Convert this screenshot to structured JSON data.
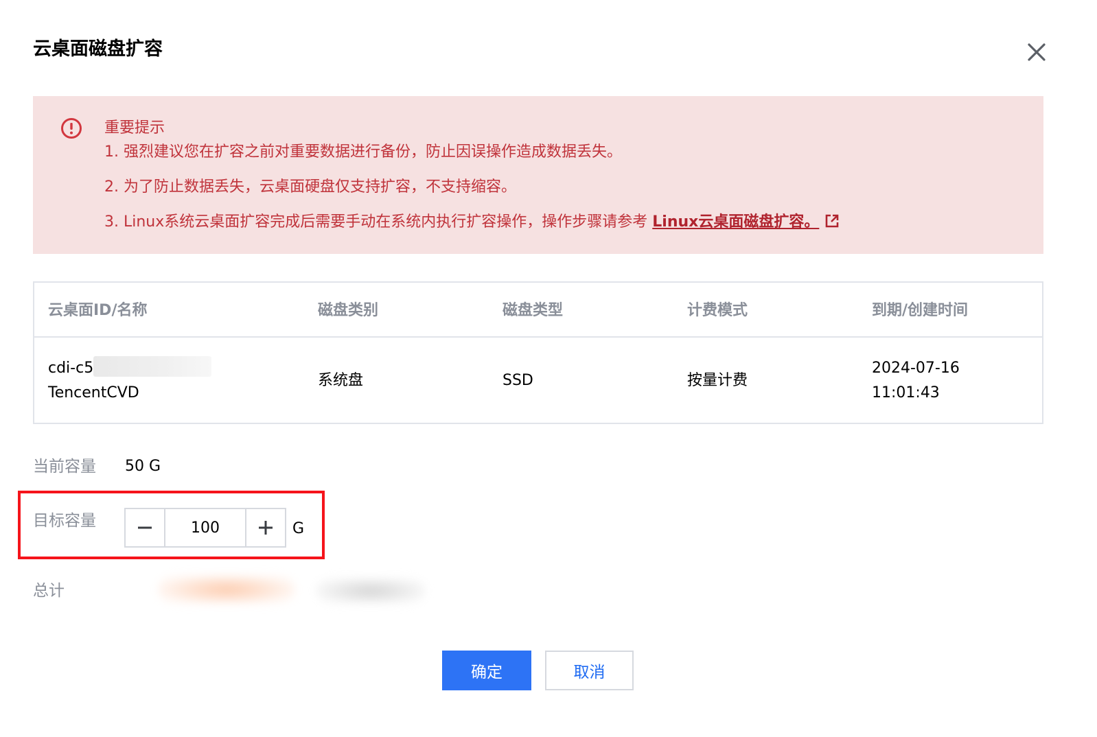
{
  "dialog": {
    "title": "云桌面磁盘扩容",
    "close_icon": "close-icon"
  },
  "alert": {
    "icon": "alert-circle-icon",
    "title": "重要提示",
    "line1": "1. 强烈建议您在扩容之前对重要数据进行备份，防止因误操作造成数据丢失。",
    "line2": "2. 为了防止数据丢失，云桌面硬盘仅支持扩容，不支持缩容。",
    "line3_prefix": "3. Linux系统云桌面扩容完成后需要手动在系统内执行扩容操作，操作步骤请参考 ",
    "line3_link": "Linux云桌面磁盘扩容。",
    "link_icon": "external-link-icon",
    "color": "#c0333b"
  },
  "table": {
    "headers": [
      "云桌面ID/名称",
      "磁盘类别",
      "磁盘类型",
      "计费模式",
      "到期/创建时间"
    ],
    "row": {
      "id": "cdi-c5",
      "name": "TencentCVD",
      "disk_category": "系统盘",
      "disk_type": "SSD",
      "billing": "按量计费",
      "date": "2024-07-16",
      "time": "11:01:43"
    }
  },
  "capacity": {
    "current_label": "当前容量",
    "current_value": "50 G",
    "target_label": "目标容量",
    "target_value": "100",
    "unit": "G",
    "minus_icon": "minus-icon",
    "plus_icon": "plus-icon"
  },
  "total": {
    "label": "总计"
  },
  "buttons": {
    "confirm": "确定",
    "cancel": "取消",
    "primary_color": "#2d73f5"
  },
  "highlight_color": "#f5141b"
}
